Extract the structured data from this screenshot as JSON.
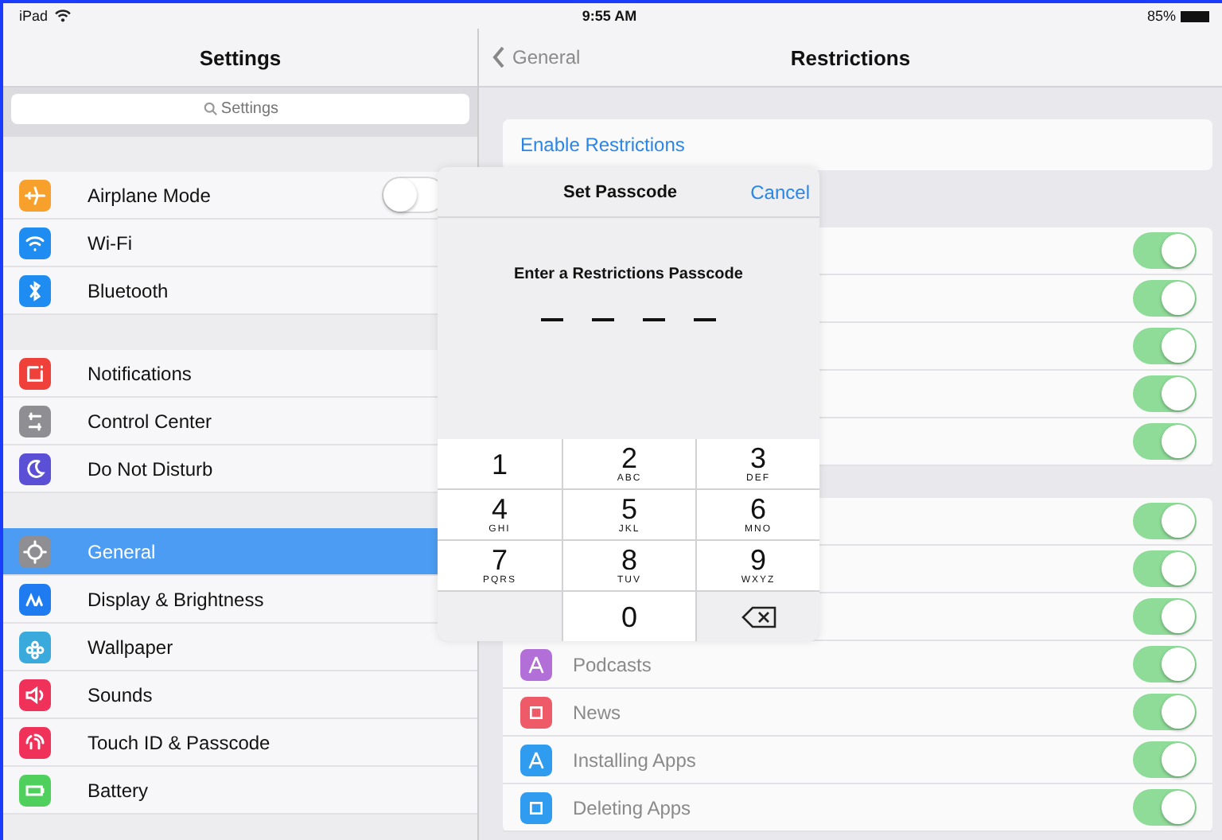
{
  "status_bar": {
    "device": "iPad",
    "time": "9:55 AM",
    "battery": "85%"
  },
  "sidebar": {
    "title": "Settings",
    "search": {
      "placeholder": "Settings"
    },
    "groups": [
      [
        {
          "label": "Airplane Mode",
          "color": "#f7a02c",
          "selected": false,
          "toggle": {
            "on": false
          }
        },
        {
          "label": "Wi-Fi",
          "color": "#1e8cf0",
          "selected": false
        },
        {
          "label": "Bluetooth",
          "color": "#1e8cf0",
          "selected": false
        }
      ],
      [
        {
          "label": "Notifications",
          "color": "#f0403a",
          "selected": false
        },
        {
          "label": "Control Center",
          "color": "#8e8e93",
          "selected": false
        },
        {
          "label": "Do Not Disturb",
          "color": "#5b4fd6",
          "selected": false
        }
      ],
      [
        {
          "label": "General",
          "color": "#8e8e93",
          "selected": true
        },
        {
          "label": "Display & Brightness",
          "color": "#1e7cf0",
          "selected": false
        },
        {
          "label": "Wallpaper",
          "color": "#3aa9dc",
          "selected": false
        },
        {
          "label": "Sounds",
          "color": "#f0325a",
          "selected": false
        },
        {
          "label": "Touch ID & Passcode",
          "color": "#f0325a",
          "selected": false
        },
        {
          "label": "Battery",
          "color": "#4fd05c",
          "selected": false
        }
      ]
    ]
  },
  "detail": {
    "back": "General",
    "title": "Restrictions",
    "enable_link": "Enable Restrictions",
    "groups": [
      [
        {
          "on": true
        },
        {
          "on": true
        },
        {
          "on": true
        },
        {
          "on": true
        },
        {
          "on": true
        }
      ],
      [
        {
          "on": true
        },
        {
          "on": true
        },
        {
          "on": true
        },
        {
          "label": "Podcasts",
          "color": "#b36fd8",
          "on": true
        },
        {
          "label": "News",
          "color": "#ef5a68",
          "on": true
        },
        {
          "label": "Installing Apps",
          "color": "#2f9cf0",
          "on": true
        },
        {
          "label": "Deleting Apps",
          "color": "#2f9cf0",
          "on": true
        }
      ]
    ]
  },
  "modal": {
    "title": "Set Passcode",
    "cancel": "Cancel",
    "prompt": "Enter a Restrictions Passcode",
    "slots": [
      {
        "filled": false
      },
      {
        "filled": false
      },
      {
        "filled": false
      },
      {
        "filled": false
      }
    ],
    "keys": [
      {
        "kind": "digit",
        "digit": "1"
      },
      {
        "kind": "digit",
        "digit": "2",
        "letters": "ABC"
      },
      {
        "kind": "digit",
        "digit": "3",
        "letters": "DEF"
      },
      {
        "kind": "digit",
        "digit": "4",
        "letters": "GHI"
      },
      {
        "kind": "digit",
        "digit": "5",
        "letters": "JKL"
      },
      {
        "kind": "digit",
        "digit": "6",
        "letters": "MNO"
      },
      {
        "kind": "digit",
        "digit": "7",
        "letters": "PQRS"
      },
      {
        "kind": "digit",
        "digit": "8",
        "letters": "TUV"
      },
      {
        "kind": "digit",
        "digit": "9",
        "letters": "WXYZ"
      },
      {
        "kind": "blank"
      },
      {
        "kind": "digit",
        "digit": "0"
      },
      {
        "kind": "delete"
      }
    ]
  }
}
